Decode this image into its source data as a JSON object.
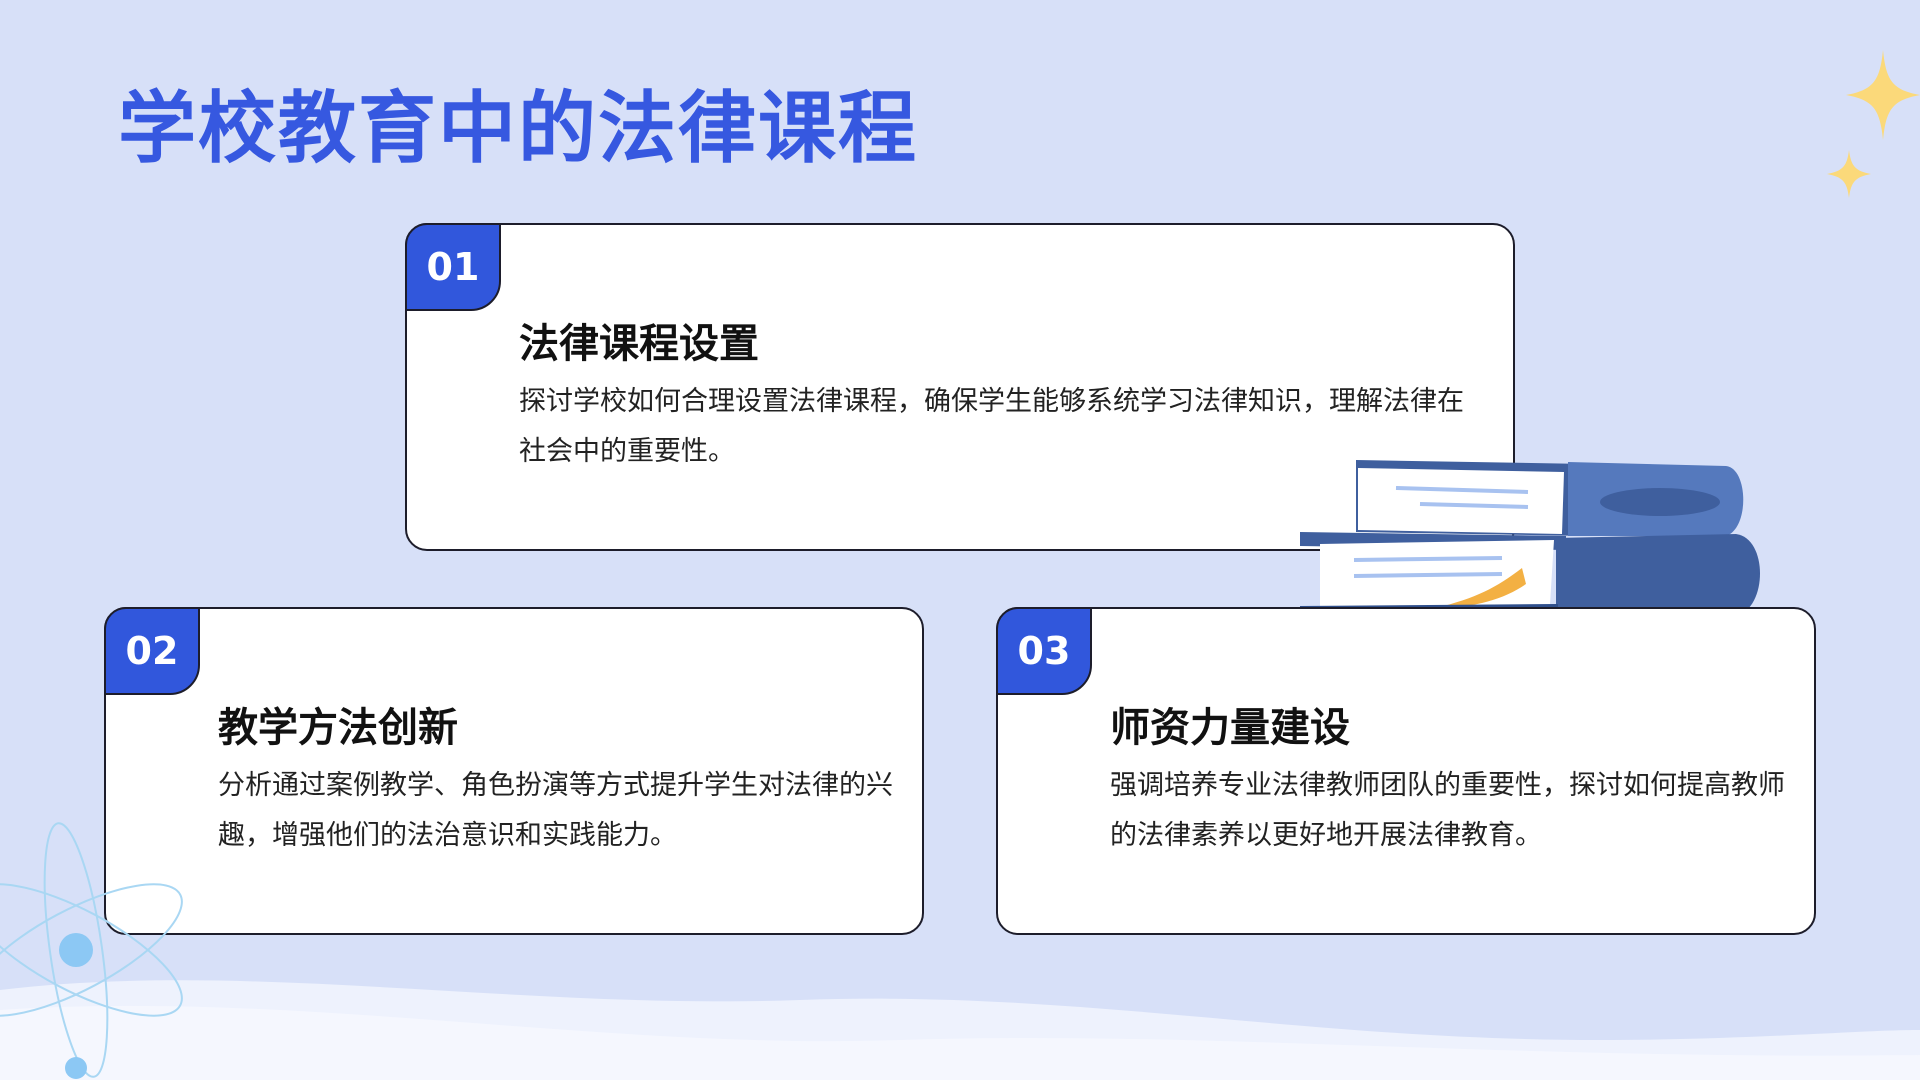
{
  "title": "学校教育中的法律课程",
  "colors": {
    "background": "#d7e0f8",
    "accent": "#3157dc",
    "title": "#3658e0",
    "sparkle": "#fbd97a",
    "book": "#3f5f9e"
  },
  "cards": [
    {
      "number": "01",
      "title": "法律课程设置",
      "description": "探讨学校如何合理设置法律课程，确保学生能够系统学习法律知识，理解法律在社会中的重要性。"
    },
    {
      "number": "02",
      "title": "教学方法创新",
      "description": "分析通过案例教学、角色扮演等方式提升学生对法律的兴趣，增强他们的法治意识和实践能力。"
    },
    {
      "number": "03",
      "title": "师资力量建设",
      "description": "强调培养专业法律教师团队的重要性，探讨如何提高教师的法律素养以更好地开展法律教育。"
    }
  ],
  "decorations": {
    "sparkle_icon": "sparkle-icon",
    "books_icon": "books-icon",
    "atom_icon": "atom-icon"
  }
}
